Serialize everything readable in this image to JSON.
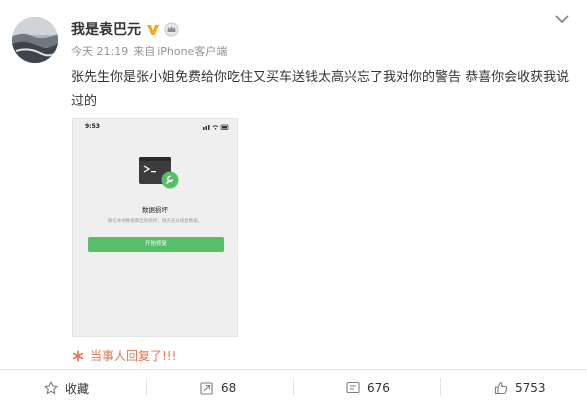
{
  "author": {
    "name": "我是袁巴元"
  },
  "meta": {
    "time": "今天 21:19",
    "source_prefix": "来自",
    "source": "iPhone客户端"
  },
  "post": {
    "text": "张先生你是张小姐免费给你吃住又买车送钱太高兴忘了我对你的警告 恭喜你会收获我说过的"
  },
  "screenshot": {
    "time": "9:53",
    "title": "数据损坏",
    "desc": "微信本地数据库出现损坏，请点击以修复数据。",
    "button": "开始修复"
  },
  "reply": {
    "text": "当事人回复了!!!"
  },
  "actions": {
    "favorite": "收藏",
    "repost": "68",
    "comment": "676",
    "like": "5753"
  },
  "colors": {
    "link_orange": "#eb7350",
    "vip_gold": "#f6a623",
    "wechat_green": "#57be6a"
  },
  "icons": [
    "vip-icon",
    "crown-icon",
    "chevron-down-icon",
    "terminal-icon",
    "wrench-icon",
    "reply-icon",
    "star-icon",
    "repost-icon",
    "comment-icon",
    "like-icon"
  ]
}
